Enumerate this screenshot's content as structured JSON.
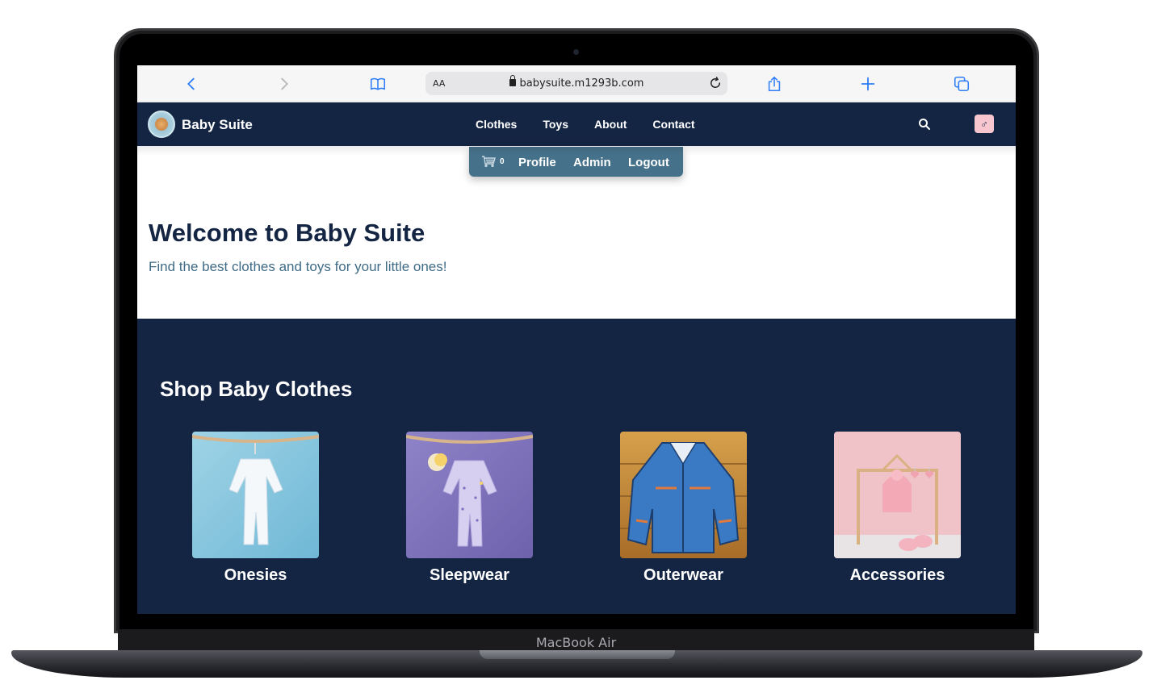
{
  "device": {
    "label": "MacBook Air"
  },
  "browser": {
    "text_size_label": "AA",
    "url": "babysuite.m1293b.com"
  },
  "site": {
    "brand": "Baby Suite",
    "nav": [
      "Clothes",
      "Toys",
      "About",
      "Contact"
    ],
    "gender_toggle": "♂",
    "user_menu": {
      "cart_count": "0",
      "profile": "Profile",
      "admin": "Admin",
      "logout": "Logout"
    }
  },
  "hero": {
    "title": "Welcome to Baby Suite",
    "subtitle": "Find the best clothes and toys for your little ones!"
  },
  "shop": {
    "title": "Shop Baby Clothes",
    "categories": [
      {
        "label": "Onesies"
      },
      {
        "label": "Sleepwear"
      },
      {
        "label": "Outerwear"
      },
      {
        "label": "Accessories"
      }
    ]
  },
  "colors": {
    "nav_bg": "#142543",
    "user_menu_bg": "#46718a",
    "accent_pink": "#f7c6cf",
    "subtitle": "#3f6b86"
  }
}
